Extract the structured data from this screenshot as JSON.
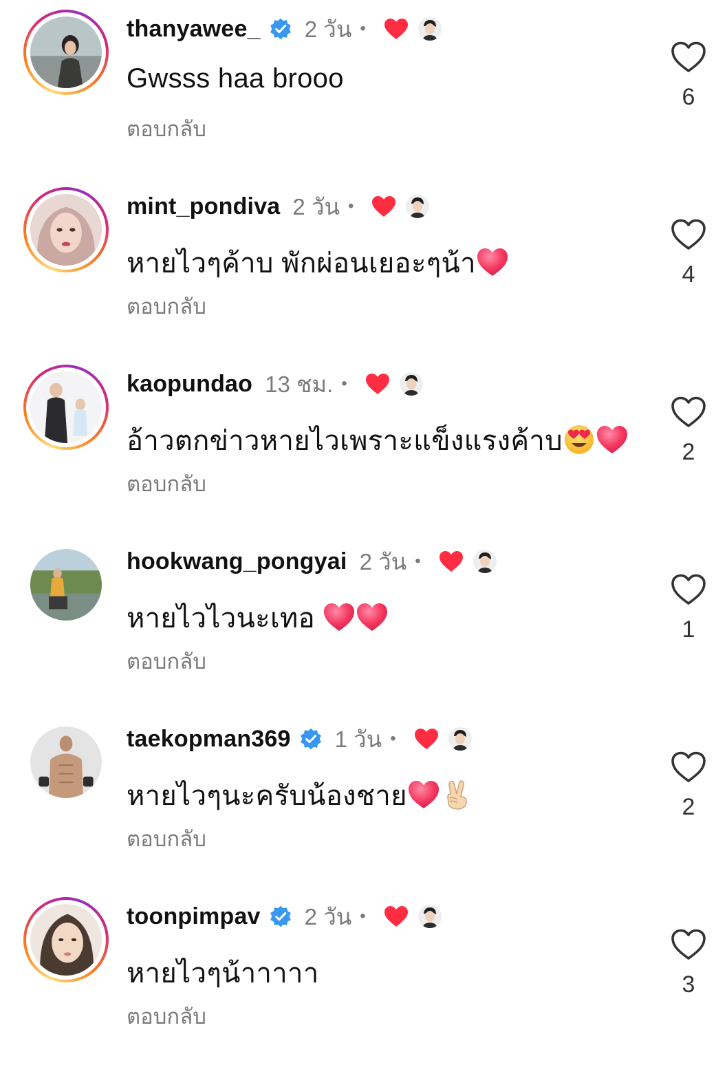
{
  "comments": [
    {
      "username": "thanyawee_",
      "verified": true,
      "time": "2 วัน",
      "dot": "•",
      "text": "Gwsss haa brooo",
      "emojis": [],
      "reply": "ตอบกลับ",
      "likes": "6",
      "avatar_ring": true
    },
    {
      "username": "mint_pondiva",
      "verified": false,
      "time": "2 วัน",
      "dot": "•",
      "text": "หายไวๆค้าบ พักผ่อนเยอะๆน้า",
      "emojis": [
        "heart-emoji"
      ],
      "reply": "ตอบกลับ",
      "likes": "4",
      "avatar_ring": true
    },
    {
      "username": "kaopundao",
      "verified": false,
      "time": "13 ชม.",
      "dot": "•",
      "text": "อ้าวตกข่าวหายไวเพราะแข็งแรงค้าบ",
      "emojis": [
        "heart-eyes-emoji",
        "heart-emoji"
      ],
      "reply": "ตอบกลับ",
      "likes": "2",
      "avatar_ring": true
    },
    {
      "username": "hookwang_pongyai",
      "verified": false,
      "time": "2 วัน",
      "dot": "•",
      "text": "หายไวไวนะเทอ ",
      "emojis": [
        "heart-emoji",
        "heart-emoji"
      ],
      "reply": "ตอบกลับ",
      "likes": "1",
      "avatar_ring": false
    },
    {
      "username": "taekopman369",
      "verified": true,
      "time": "1 วัน",
      "dot": "•",
      "text": "หายไวๆนะครับน้องชาย",
      "emojis": [
        "heart-emoji",
        "victory-hand-emoji"
      ],
      "reply": "ตอบกลับ",
      "likes": "2",
      "avatar_ring": false
    },
    {
      "username": "toonpimpav",
      "verified": true,
      "time": "2 วัน",
      "dot": "•",
      "text": "หายไวๆน้าาาาา",
      "emojis": [],
      "reply": "ตอบกลับ",
      "likes": "3",
      "avatar_ring": true
    }
  ],
  "colors": {
    "verified": "#3897f0",
    "liked_heart": "#ff2d42",
    "muted_text": "#7a7a7a"
  }
}
